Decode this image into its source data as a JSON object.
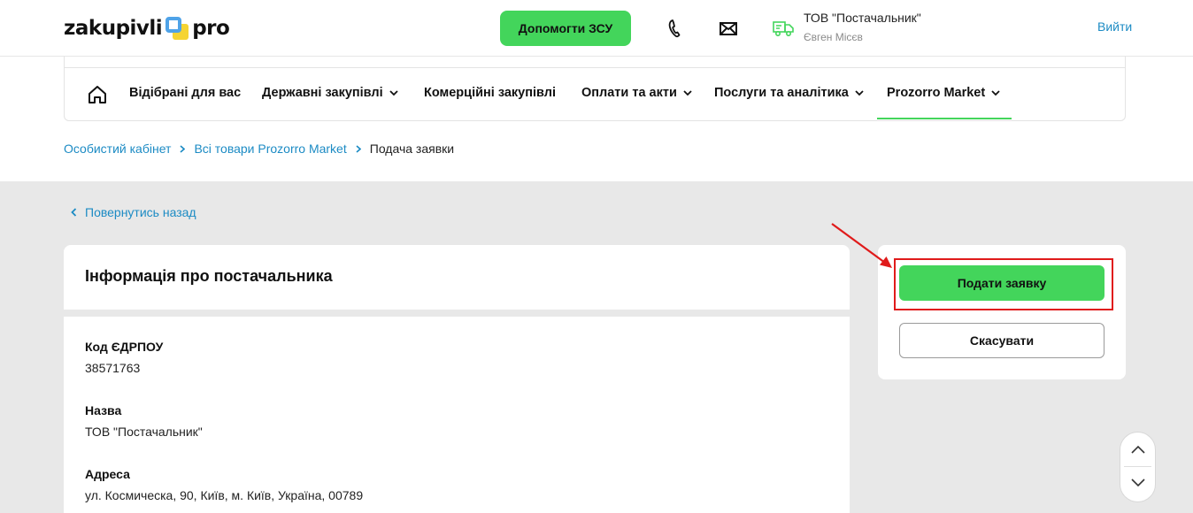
{
  "header": {
    "logo_left": "zakupivli",
    "logo_right": "pro",
    "help_button": "Допомогти ЗСУ",
    "organization": "ТОВ \"Постачальник\"",
    "user_name": "Євген Місєв",
    "logout": "Вийти"
  },
  "nav": {
    "items": [
      {
        "label": "Відібрані для вас"
      },
      {
        "label": "Державні закупівлі"
      },
      {
        "label": "Комерційні закупівлі"
      },
      {
        "label": "Оплати та акти"
      },
      {
        "label": "Послуги та аналітика"
      },
      {
        "label": "Prozorro Market"
      }
    ],
    "active": "Prozorro Market"
  },
  "breadcrumb": {
    "items": [
      "Особистий кабінет",
      "Всі товари Prozorro Market"
    ],
    "current": "Подача заявки"
  },
  "back_link": "Повернутись назад",
  "supplier_card": {
    "title": "Інформація про постачальника",
    "fields": [
      {
        "label": "Код ЄДРПОУ",
        "value": "38571763"
      },
      {
        "label": "Назва",
        "value": "ТОВ \"Постачальник\""
      },
      {
        "label": "Адреса",
        "value": "ул. Космическа, 90, Київ, м. Київ, Україна, 00789"
      }
    ]
  },
  "actions": {
    "submit": "Подати заявку",
    "cancel": "Скасувати"
  },
  "colors": {
    "accent_green": "#43d55b",
    "link_blue": "#1c8bc4",
    "annotation_red": "#e01b1b",
    "page_grey": "#e8e8e8"
  },
  "icons": [
    "phone-icon",
    "mail-icon",
    "truck-icon",
    "home-icon",
    "chevron-down-icon",
    "chevron-right-icon",
    "chevron-left-icon",
    "chevron-up-icon",
    "red-arrow-annotation"
  ]
}
